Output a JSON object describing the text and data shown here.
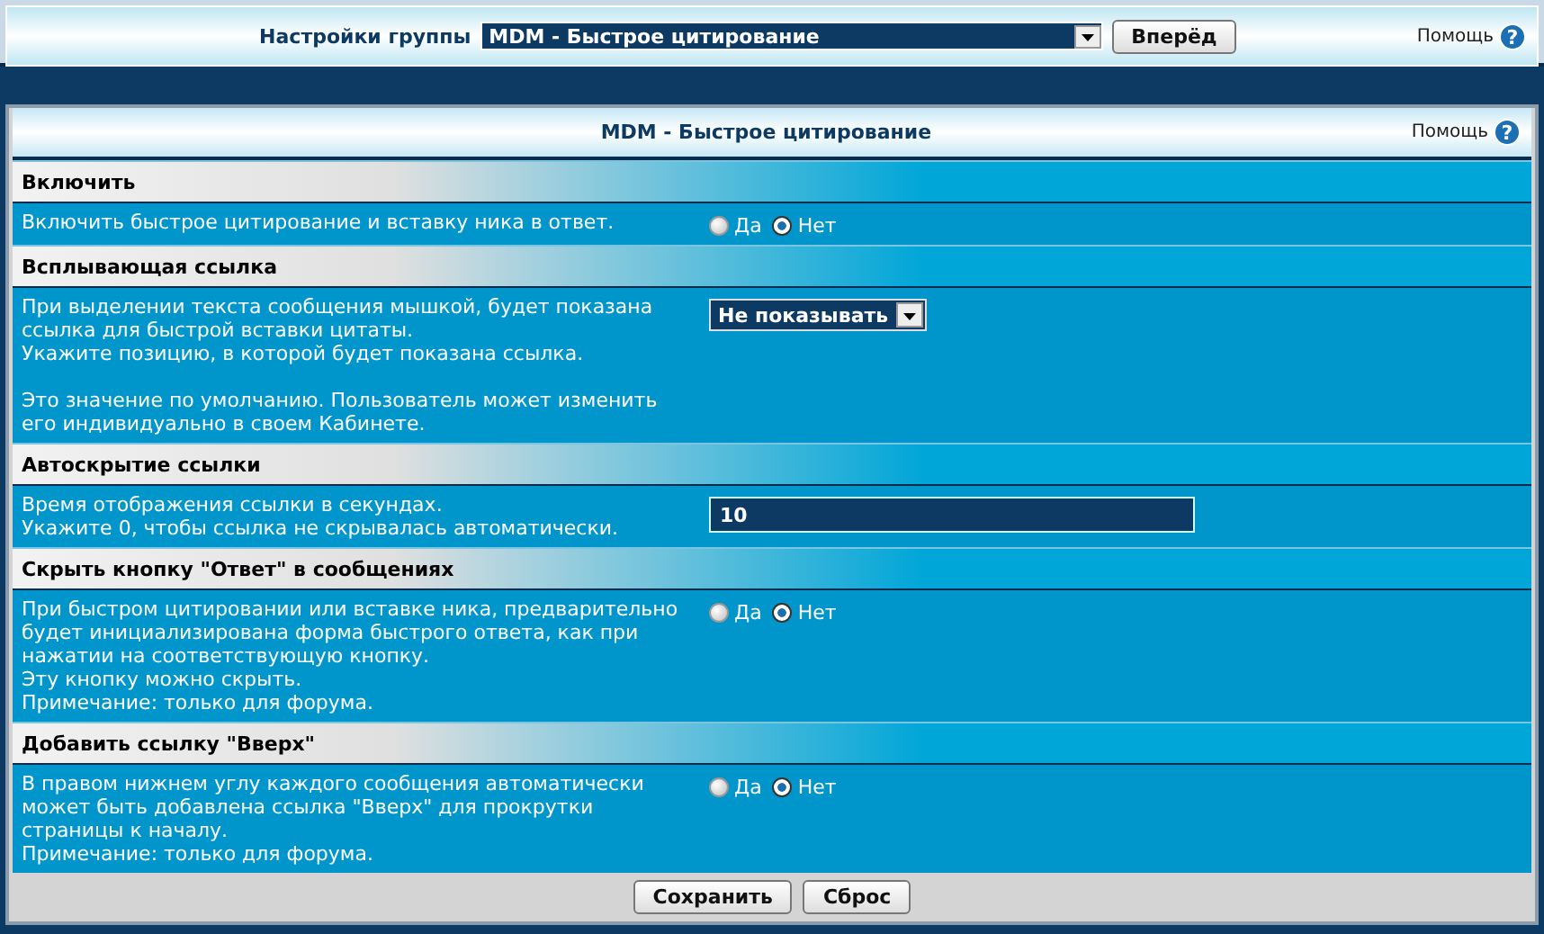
{
  "top_bar": {
    "label": "Настройки группы",
    "group_select": {
      "value": "MDM - Быстрое цитирование"
    },
    "button": "Вперёд",
    "help": "Помощь",
    "help_icon": "?"
  },
  "panel": {
    "title": "MDM - Быстрое цитирование",
    "help": "Помощь",
    "help_icon": "?"
  },
  "sections": [
    {
      "heading": "Включить",
      "paragraphs": [
        [
          "Включить быстрое цитирование и вставку ника в ответ."
        ]
      ],
      "control": {
        "kind": "radio",
        "options": [
          {
            "label": "Да",
            "selected": false
          },
          {
            "label": "Нет",
            "selected": true
          }
        ]
      }
    },
    {
      "heading": "Всплывающая ссылка",
      "paragraphs": [
        [
          "При выделении текста сообщения мышкой, будет показана",
          "ссылка для быстрой вставки цитаты.",
          "Укажите позицию, в которой будет показана ссылка."
        ],
        [
          "Это значение по умолчанию. Пользователь может изменить",
          "его индивидуально в своем Кабинете."
        ]
      ],
      "control": {
        "kind": "select",
        "value": "Не показывать"
      }
    },
    {
      "heading": "Автоскрытие ссылки",
      "paragraphs": [
        [
          "Время отображения ссылки в секундах.",
          "Укажите 0, чтобы ссылка не скрывалась автоматически."
        ]
      ],
      "control": {
        "kind": "text",
        "value": "10"
      }
    },
    {
      "heading": "Скрыть кнопку \"Ответ\" в сообщениях",
      "paragraphs": [
        [
          "При быстром цитировании или вставке ника, предварительно",
          "будет инициализирована форма быстрого ответа, как при",
          "нажатии на соответствующую кнопку.",
          "Эту кнопку можно скрыть.",
          "Примечание: только для форума."
        ]
      ],
      "control": {
        "kind": "radio",
        "options": [
          {
            "label": "Да",
            "selected": false
          },
          {
            "label": "Нет",
            "selected": true
          }
        ]
      }
    },
    {
      "heading": "Добавить ссылку \"Вверх\"",
      "paragraphs": [
        [
          "В правом нижнем углу каждого сообщения автоматически",
          "может быть добавлена ссылка \"Вверх\" для прокрутки",
          "страницы к началу.",
          "Примечание: только для форума."
        ]
      ],
      "control": {
        "kind": "radio",
        "options": [
          {
            "label": "Да",
            "selected": false
          },
          {
            "label": "Нет",
            "selected": true
          }
        ]
      }
    }
  ],
  "buttons": [
    "Сохранить",
    "Сброс"
  ]
}
